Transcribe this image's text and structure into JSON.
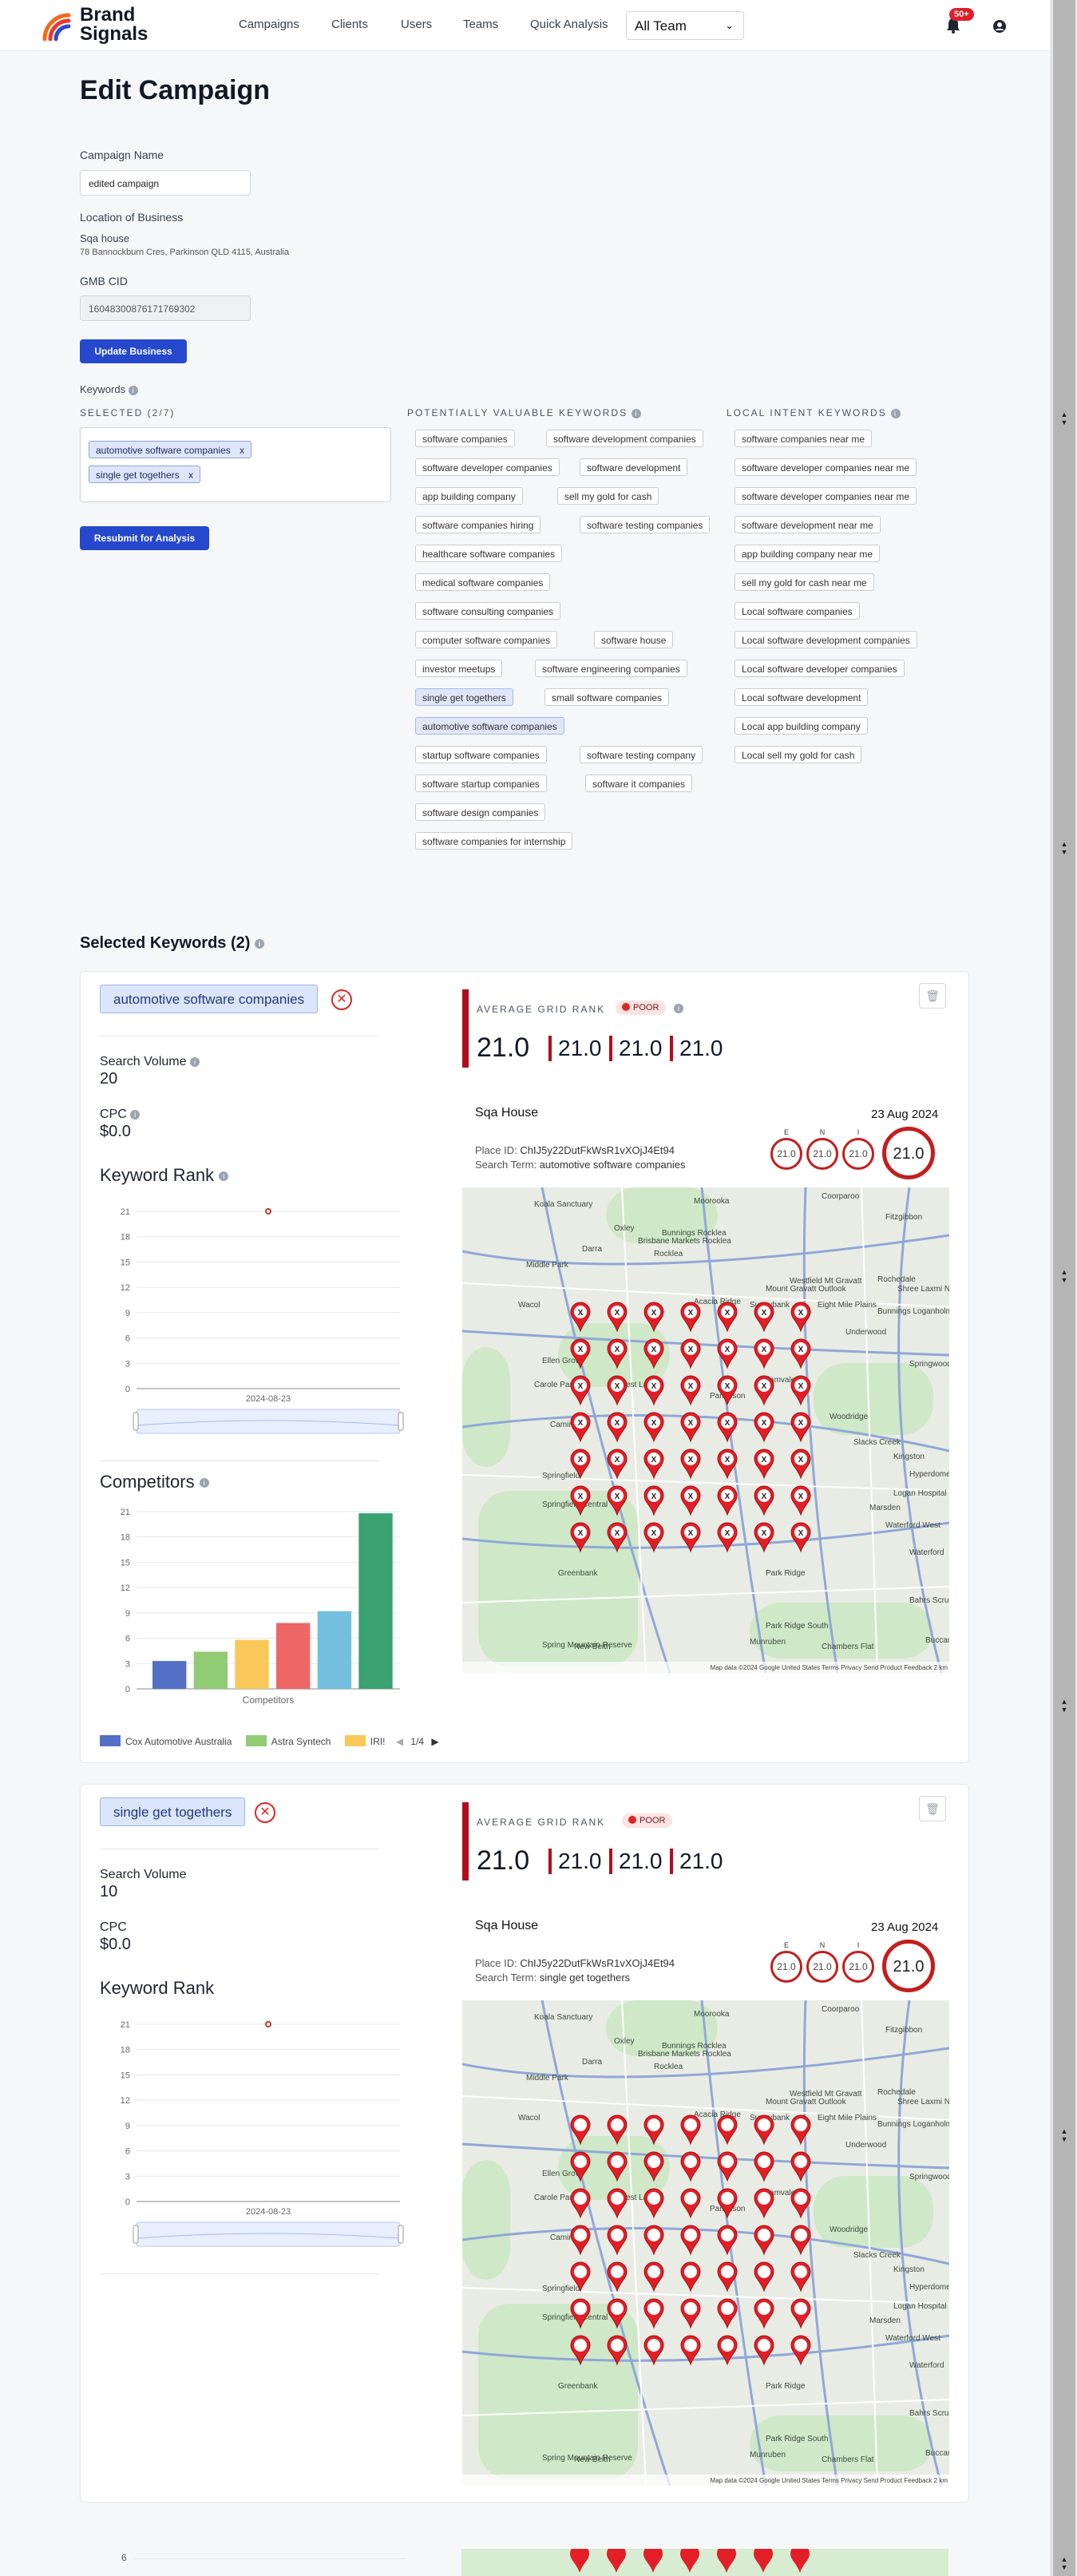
{
  "nav": {
    "brand": "Brand Signals",
    "links": [
      "Campaigns",
      "Clients",
      "Users",
      "Teams",
      "Quick Analysis"
    ],
    "team_select": "All Team",
    "badge": "50+"
  },
  "page": {
    "title": "Edit Campaign"
  },
  "form": {
    "campaign_name_label": "Campaign Name",
    "campaign_name_value": "edited campaign",
    "location_label": "Location of Business",
    "business_name": "Sqa house",
    "business_address": "78 Bannockburn Cres, Parkinson QLD 4115, Australia",
    "gmb_label": "GMB CID",
    "gmb_value": "16048300876171769302",
    "update_button": "Update Business",
    "keywords_label": "Keywords",
    "resubmit_button": "Resubmit for Analysis"
  },
  "keywords": {
    "selected_title": "SELECTED (2/7)",
    "selected": [
      "automotive software companies",
      "single get togethers"
    ],
    "potential_title": "POTENTIALLY VALUABLE KEYWORDS",
    "potential": [
      "software companies",
      "software development companies",
      "software developer companies",
      "software development",
      "app building company",
      "sell my gold for cash",
      "software companies hiring",
      "software testing companies",
      "healthcare software companies",
      "medical software companies",
      "software consulting companies",
      "computer software companies",
      "software house",
      "investor meetups",
      "software engineering companies",
      "single get togethers",
      "small software companies",
      "automotive software companies",
      "startup software companies",
      "software testing company",
      "software startup companies",
      "software it companies",
      "software design companies",
      "software companies for internship"
    ],
    "local_title": "LOCAL INTENT KEYWORDS",
    "local": [
      "software companies near me",
      "software developer companies near me",
      "software developer companies near me",
      "software development near me",
      "app building company near me",
      "sell my gold for cash near me",
      "Local software companies",
      "Local software development companies",
      "Local software developer companies",
      "Local software development",
      "Local app building company",
      "Local sell my gold for cash"
    ]
  },
  "selected_section": {
    "title": "Selected Keywords (2)"
  },
  "cards": [
    {
      "keyword": "automotive software companies",
      "search_volume_label": "Search Volume",
      "search_volume": "20",
      "cpc_label": "CPC",
      "cpc": "$0.0",
      "keyword_rank_label": "Keyword Rank",
      "rank_chart": {
        "type": "line",
        "x": [
          "2024-08-23"
        ],
        "y": [
          21
        ],
        "yticks": [
          "0",
          "3",
          "6",
          "9",
          "12",
          "15",
          "18",
          "21"
        ],
        "ylim": [
          0,
          21
        ],
        "xlabel_tick": "2024-08-23"
      },
      "competitors_label": "Competitors",
      "competitors_chart": {
        "type": "bar",
        "xlabel": "Competitors",
        "yticks": [
          "0",
          "3",
          "6",
          "9",
          "12",
          "15",
          "18",
          "21"
        ],
        "ylim": [
          0,
          21
        ],
        "values": [
          3.3,
          4.4,
          5.8,
          7.8,
          9.2,
          20.8
        ],
        "colors": [
          "#5470c6",
          "#91cc75",
          "#fac858",
          "#ee6666",
          "#73c0de",
          "#3ba272"
        ],
        "legend": [
          {
            "name": "Cox Automotive Australia",
            "color": "#5470c6"
          },
          {
            "name": "Astra Syntech",
            "color": "#91cc75"
          },
          {
            "name": "IRI!",
            "color": "#fac858"
          }
        ],
        "pager": "1/4"
      },
      "avg_grid_rank_label": "AVERAGE GRID RANK",
      "rank_status": "POOR",
      "avg_rank": "21.0",
      "sub_ranks": [
        "21.0",
        "21.0",
        "21.0"
      ],
      "business": "Sqa House",
      "date": "23 Aug 2024",
      "place_id_label": "Place ID:",
      "place_id": "ChIJ5y22DutFkWsR1vXOjJ4Et94",
      "search_term_label": "Search Term:",
      "search_term": "automotive software companies",
      "rings": [
        {
          "label": "E",
          "value": "21.0"
        },
        {
          "label": "N",
          "value": "21.0"
        },
        {
          "label": "I",
          "value": "21.0"
        }
      ],
      "overall": "21.0"
    },
    {
      "keyword": "single get togethers",
      "search_volume_label": "Search Volume",
      "search_volume": "10",
      "cpc_label": "CPC",
      "cpc": "$0.0",
      "keyword_rank_label": "Keyword Rank",
      "rank_chart": {
        "type": "line",
        "x": [
          "2024-08-23"
        ],
        "y": [
          21
        ],
        "yticks": [
          "0",
          "3",
          "6",
          "9",
          "12",
          "15",
          "18",
          "21"
        ],
        "ylim": [
          0,
          21
        ],
        "xlabel_tick": "2024-08-23"
      },
      "avg_grid_rank_label": "AVERAGE GRID RANK",
      "rank_status": "POOR",
      "avg_rank": "21.0",
      "sub_ranks": [
        "21.0",
        "21.0",
        "21.0"
      ],
      "business": "Sqa House",
      "date": "23 Aug 2024",
      "place_id_label": "Place ID:",
      "place_id": "ChIJ5y22DutFkWsR1vXOjJ4Et94",
      "search_term_label": "Search Term:",
      "search_term": "single get togethers",
      "rings": [
        {
          "label": "E",
          "value": "21.0"
        },
        {
          "label": "N",
          "value": "21.0"
        },
        {
          "label": "I",
          "value": "21.0"
        }
      ],
      "overall": "21.0"
    }
  ],
  "map": {
    "places": [
      "Moorooka",
      "Coorparoo",
      "Koala Sanctuary",
      "Oxley",
      "Darra",
      "Rocklea",
      "Middle Park",
      "Wacol",
      "Acacia Ridge",
      "Sunnybank",
      "Eight Mile Plains",
      "Rochedale",
      "Underwood",
      "Springwood",
      "Ellen Grove",
      "Carole Park",
      "Forest Lake",
      "Calamvale",
      "Parkinson",
      "Woodridge",
      "Slacks Creek",
      "Camira",
      "Springfield",
      "Springfield Central",
      "Marsden",
      "Logan Hospital",
      "Waterford West",
      "Greenbank",
      "Park Ridge",
      "Spring Mountain Reserve",
      "Park Ridge South",
      "New Beith",
      "Chambers Flat",
      "Munruben",
      "Buccan",
      "Bahrs Scrub",
      "Waterford",
      "Bunnings Loganholme",
      "Mount Gravatt Outlook",
      "Westfield Mt Gravatt",
      "Shree Laxmi Narayan Mandir",
      "Bunnings Rocklea",
      "Brisbane Markets Rocklea",
      "Hyperdome Shopping Centre",
      "Kingston",
      "Fitzgibbon"
    ],
    "pin_label": "X",
    "attribution": "Map data ©2024 Google   United States   Terms   Privacy   Send Product Feedback   2 km"
  },
  "partial_row": {
    "rank_tick": "6"
  }
}
